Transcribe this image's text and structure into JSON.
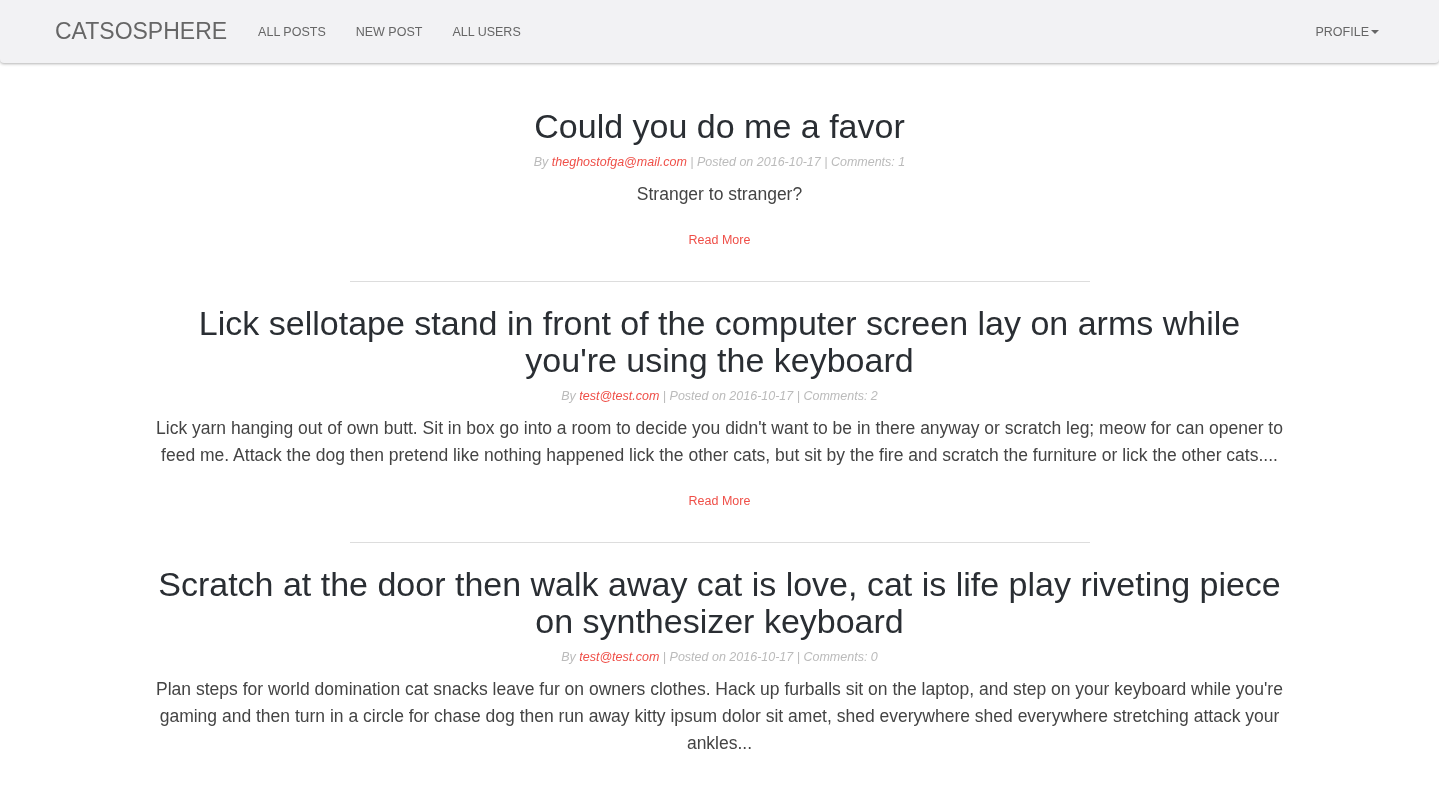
{
  "navbar": {
    "brand": "CATSOSPHERE",
    "links": [
      {
        "label": "ALL POSTS"
      },
      {
        "label": "NEW POST"
      },
      {
        "label": "ALL USERS"
      }
    ],
    "profile": "PROFILE"
  },
  "posts": [
    {
      "title": "Could you do me a favor",
      "by": "By",
      "author": "theghostofga@mail.com",
      "details": "| Posted on 2016-10-17 | Comments: 1",
      "excerpt": "Stranger to stranger?",
      "read_more": "Read More"
    },
    {
      "title": "Lick sellotape stand in front of the computer screen lay on arms while you're using the keyboard",
      "by": "By",
      "author": "test@test.com",
      "details": "| Posted on 2016-10-17 | Comments: 2",
      "excerpt": "Lick yarn hanging out of own butt. Sit in box go into a room to decide you didn't want to be in there anyway or scratch leg; meow for can opener to feed me. Attack the dog then pretend like nothing happened lick the other cats, but sit by the fire and scratch the furniture or lick the other cats....",
      "read_more": "Read More"
    },
    {
      "title": "Scratch at the door then walk away cat is love, cat is life play riveting piece on synthesizer keyboard",
      "by": "By",
      "author": "test@test.com",
      "details": "| Posted on 2016-10-17 | Comments: 0",
      "excerpt": "Plan steps for world domination cat snacks leave fur on owners clothes. Hack up furballs sit on the laptop, and step on your keyboard while you're gaming and then turn in a circle for chase dog then run away kitty ipsum dolor sit amet, shed everywhere shed everywhere stretching attack your ankles..."
    }
  ]
}
